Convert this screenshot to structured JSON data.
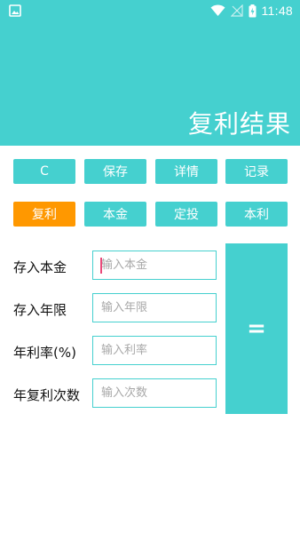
{
  "status_bar": {
    "time": "11:48",
    "icons": [
      "image-icon",
      "wifi-icon",
      "signal-icon",
      "battery-charging-icon"
    ]
  },
  "header": {
    "title": "复利结果",
    "color": "#45d0cf"
  },
  "toolbar": {
    "clear_label": "C",
    "save_label": "保存",
    "details_label": "详情",
    "records_label": "记录"
  },
  "modes": {
    "selected": "复利",
    "compound_label": "复利",
    "principal_label": "本金",
    "fixed_invest_label": "定投",
    "principal_interest_label": "本利",
    "active_color": "#ff9800"
  },
  "form": {
    "principal": {
      "label": "存入本金",
      "placeholder": "输入本金",
      "value": ""
    },
    "years": {
      "label": "存入年限",
      "placeholder": "输入年限",
      "value": ""
    },
    "rate": {
      "label": "年利率(%)",
      "placeholder": "输入利率",
      "value": ""
    },
    "times": {
      "label": "年复利次数",
      "placeholder": "输入次数",
      "value": ""
    }
  },
  "equals_label": "="
}
